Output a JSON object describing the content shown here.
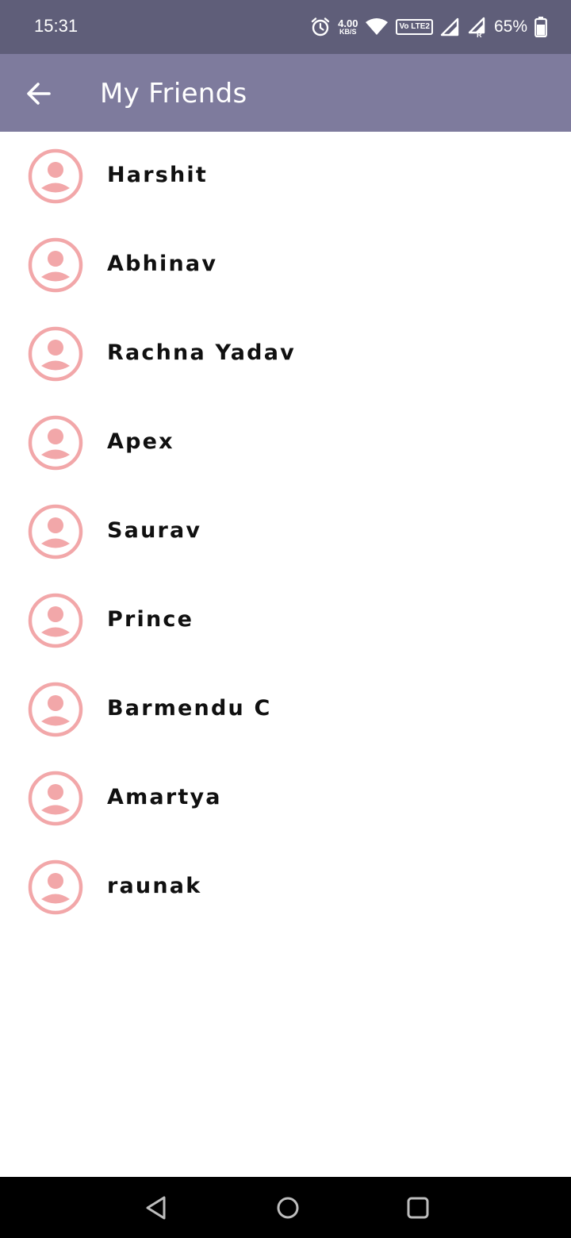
{
  "status_bar": {
    "time": "15:31",
    "net_speed_value": "4.00",
    "net_speed_unit": "KB/S",
    "volte_label": "Vo LTE2",
    "battery_percent": "65%",
    "icons": [
      "alarm-icon",
      "wifi-icon",
      "volte-icon",
      "signal-icon",
      "signal-roaming-icon",
      "battery-icon"
    ]
  },
  "app_bar": {
    "title": "My Friends",
    "back_icon": "arrow-left-icon"
  },
  "friends": [
    {
      "name": "Harshit"
    },
    {
      "name": "Abhinav"
    },
    {
      "name": "Rachna Yadav"
    },
    {
      "name": "Apex"
    },
    {
      "name": "Saurav"
    },
    {
      "name": "Prince"
    },
    {
      "name": "Barmendu C"
    },
    {
      "name": "Amartya"
    },
    {
      "name": "raunak"
    }
  ],
  "nav_bar": {
    "icons": [
      "nav-back-icon",
      "nav-home-icon",
      "nav-recent-icon"
    ]
  },
  "colors": {
    "status_bar_bg": "#5f5e79",
    "app_bar_bg": "#7e7b9d",
    "avatar_pink": "#f2a7a9",
    "nav_bar_bg": "#000000"
  }
}
